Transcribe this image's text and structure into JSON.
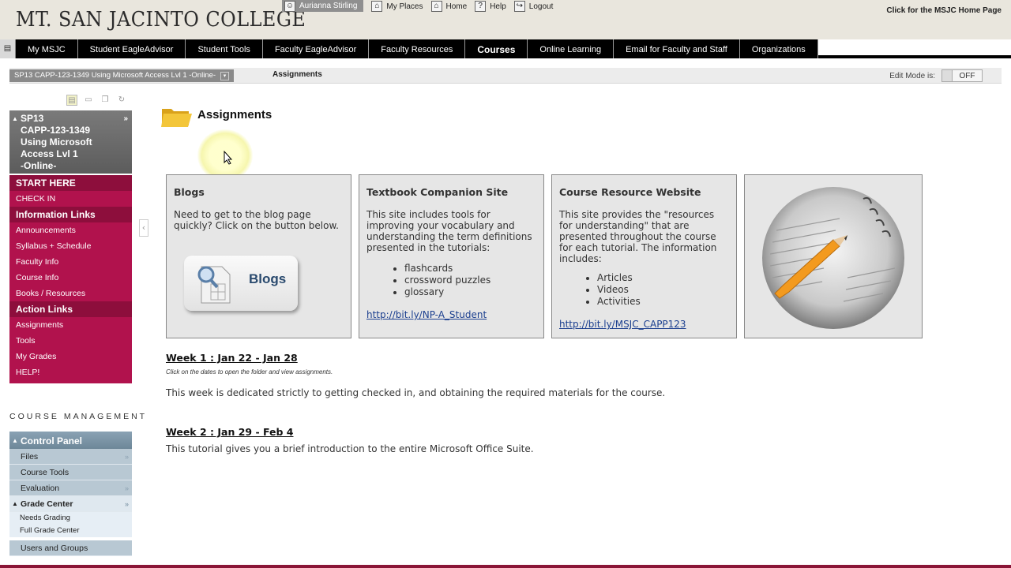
{
  "header": {
    "college_name": "MT. SAN JACINTO COLLEGE",
    "user_name": "Aurianna Stirling",
    "links": [
      "My Places",
      "Home",
      "Help",
      "Logout"
    ],
    "home_page_link": "Click for the MSJC Home Page"
  },
  "nav": {
    "tabs": [
      "My MSJC",
      "Student EagleAdvisor",
      "Student Tools",
      "Faculty EagleAdvisor",
      "Faculty Resources",
      "Courses",
      "Online Learning",
      "Email for Faculty and Staff",
      "Organizations"
    ],
    "active_tab": "Courses"
  },
  "breadcrumb": {
    "course": "SP13 CAPP-123-1349 Using Microsoft Access Lvl 1 -Online-",
    "page": "Assignments",
    "edit_mode_label": "Edit Mode is:",
    "edit_mode_value": "OFF"
  },
  "course_menu": {
    "title_lines": [
      "SP13",
      "CAPP-123-1349",
      "Using Microsoft",
      "Access Lvl 1",
      "-Online-"
    ],
    "sections": [
      {
        "heading": "START HERE",
        "items": [
          "CHECK IN"
        ]
      },
      {
        "heading": "Information Links",
        "items": [
          "Announcements",
          "Syllabus + Schedule",
          "Faculty Info",
          "Course Info",
          "Books / Resources"
        ]
      },
      {
        "heading": "Action Links",
        "items": [
          "Assignments",
          "Tools",
          "My Grades",
          "HELP!"
        ]
      }
    ]
  },
  "management": {
    "label": "COURSE MANAGEMENT",
    "control_panel": "Control Panel",
    "items": [
      "Files",
      "Course Tools",
      "Evaluation"
    ],
    "grade_center": "Grade Center",
    "grade_center_items": [
      "Needs Grading",
      "Full Grade Center"
    ],
    "users_and_groups": "Users and Groups"
  },
  "content": {
    "title": "Assignments",
    "cards": {
      "blogs": {
        "heading": "Blogs",
        "text": "Need to get to the blog page quickly? Click on the button below.",
        "button_label": "Blogs"
      },
      "textbook": {
        "heading": "Textbook Companion Site",
        "text": "This site includes tools for improving your vocabulary and understanding the term definitions presented in the tutorials:",
        "bullets": [
          "flashcards",
          "crossword puzzles",
          "glossary"
        ],
        "link": "http://bit.ly/NP-A_Student"
      },
      "course_resource": {
        "heading": "Course Resource Website",
        "text": "This site provides the \"resources for understanding\" that are presented throughout the course for each tutorial. The information includes:",
        "bullets": [
          "Articles",
          "Videos",
          "Activities"
        ],
        "link": "http://bit.ly/MSJC_CAPP123"
      }
    },
    "weeks": [
      {
        "title": "Week 1 : Jan 22 - Jan 28",
        "hint": "Click on the dates to open the folder and view assignments.",
        "description": "This week is dedicated strictly to getting checked in, and obtaining the required materials for the course."
      },
      {
        "title": "Week 2 : Jan 29 - Feb 4",
        "description": "This tutorial gives you a brief introduction to the entire Microsoft Office Suite."
      }
    ]
  },
  "colors": {
    "menu_bg": "#b1124d",
    "menu_heading": "#8d0e3c",
    "control_panel": "#8aa2b4",
    "link": "#1b3f8f"
  }
}
